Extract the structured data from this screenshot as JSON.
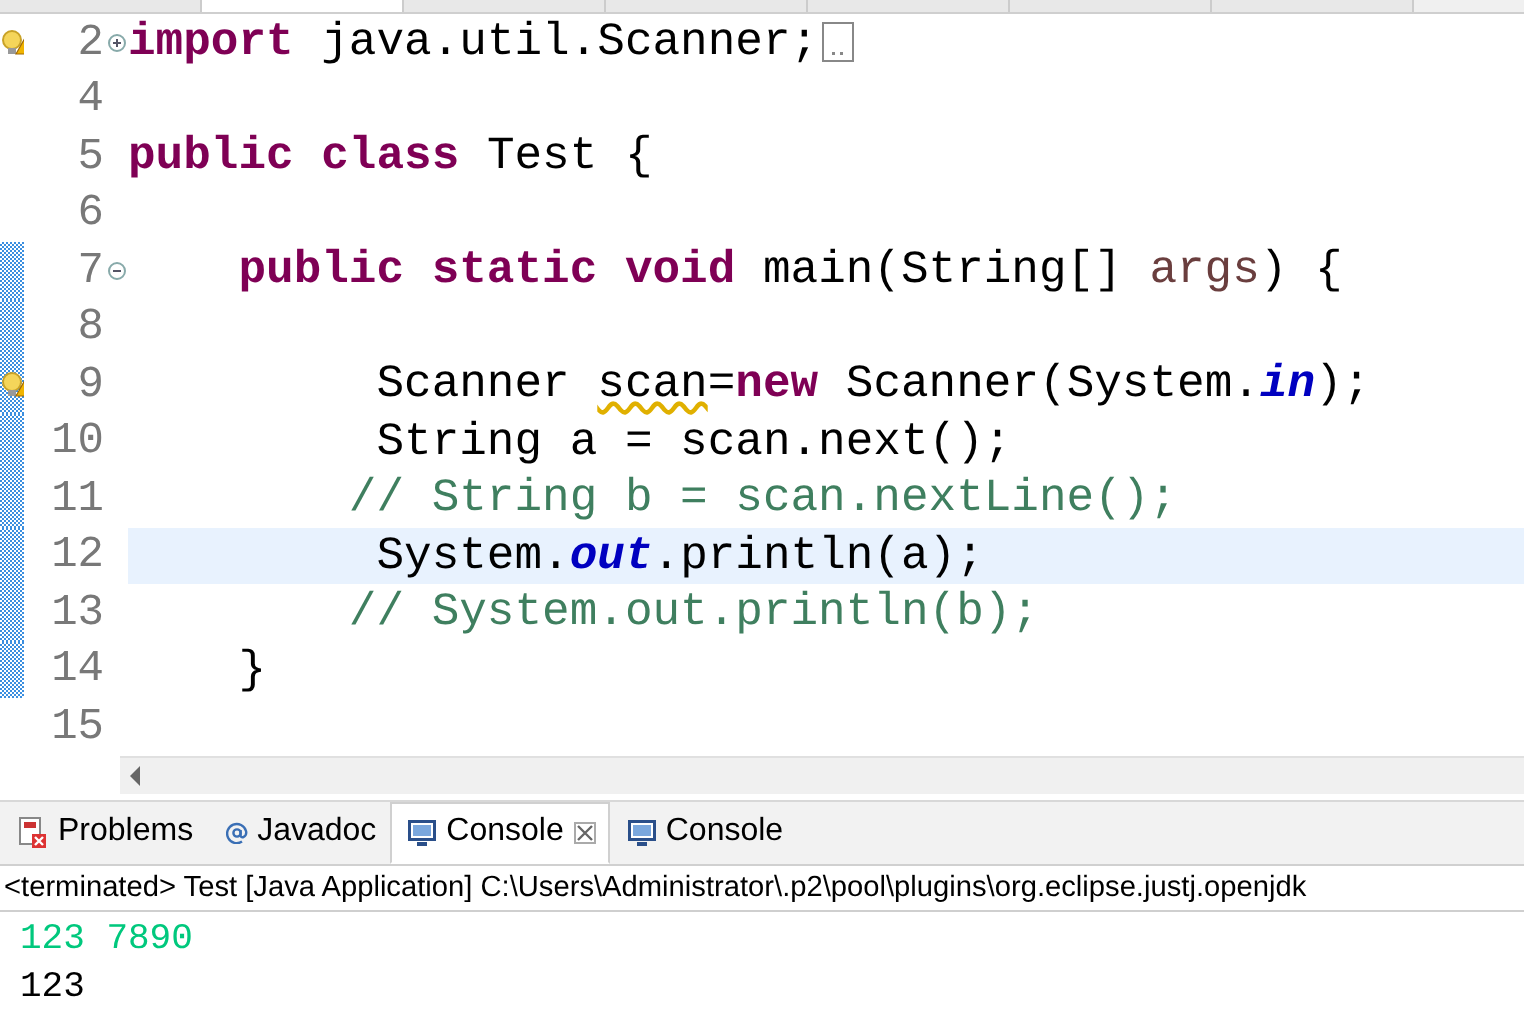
{
  "editor": {
    "lines": [
      {
        "number": "2",
        "current": false,
        "warning": true,
        "in_range": false,
        "fold": {
          "expanded": false
        },
        "segments": [
          {
            "kind": "keyword",
            "text": "import"
          },
          {
            "kind": "plain",
            "text": " java.util.Scanner;"
          }
        ]
      },
      {
        "number": "4",
        "current": false,
        "warning": false,
        "in_range": false
      },
      {
        "number": "5",
        "current": false,
        "warning": false,
        "in_range": false,
        "segments": [
          {
            "kind": "keyword",
            "text": "public class"
          },
          {
            "kind": "plain",
            "text": " Test {"
          }
        ]
      },
      {
        "number": "6",
        "current": false,
        "warning": false,
        "in_range": false
      },
      {
        "number": "7",
        "current": false,
        "warning": false,
        "in_range": true,
        "fold": {
          "expanded": true
        },
        "segments": [
          {
            "kind": "keyword",
            "text": "    public static void"
          },
          {
            "kind": "plain",
            "text": " main(String[] "
          },
          {
            "kind": "param",
            "text": "args"
          },
          {
            "kind": "plain",
            "text": ") {"
          }
        ]
      },
      {
        "number": "8",
        "current": false,
        "warning": false,
        "in_range": true
      },
      {
        "number": "9",
        "current": false,
        "warning": true,
        "in_range": true,
        "segments": [
          {
            "kind": "plain",
            "text": "         Scanner "
          },
          {
            "kind": "warned",
            "text": "scan"
          },
          {
            "kind": "plain",
            "text": "="
          },
          {
            "kind": "keyword",
            "text": "new"
          },
          {
            "kind": "plain",
            "text": " Scanner(System."
          },
          {
            "kind": "field",
            "text": "in"
          },
          {
            "kind": "plain",
            "text": ");"
          }
        ]
      },
      {
        "number": "10",
        "current": false,
        "warning": false,
        "in_range": true,
        "segments": [
          {
            "kind": "plain",
            "text": "         String a = scan.next();"
          }
        ]
      },
      {
        "number": "11",
        "current": false,
        "warning": false,
        "in_range": true,
        "segments": [
          {
            "kind": "comment",
            "text": "        // String b = scan.nextLine();"
          }
        ]
      },
      {
        "number": "12",
        "current": true,
        "warning": false,
        "in_range": true,
        "segments": [
          {
            "kind": "plain",
            "text": "         System."
          },
          {
            "kind": "field",
            "text": "out"
          },
          {
            "kind": "plain",
            "text": ".println(a);"
          }
        ]
      },
      {
        "number": "13",
        "current": false,
        "warning": false,
        "in_range": true,
        "segments": [
          {
            "kind": "comment",
            "text": "        // System.out.println(b);"
          }
        ]
      },
      {
        "number": "14",
        "current": false,
        "warning": false,
        "in_range": true,
        "segments": [
          {
            "kind": "plain",
            "text": "    }"
          }
        ]
      },
      {
        "number": "15",
        "current": false,
        "warning": false,
        "in_range": false
      }
    ]
  },
  "panel": {
    "tabs": [
      {
        "kind": "problems",
        "label": "Problems",
        "selected": false
      },
      {
        "kind": "javadoc",
        "label": "Javadoc",
        "selected": false
      },
      {
        "kind": "console",
        "label": "Console",
        "selected": true
      },
      {
        "kind": "console",
        "label": "Console",
        "selected": false
      }
    ],
    "console_header": "<terminated> Test [Java Application] C:\\Users\\Administrator\\.p2\\pool\\plugins\\org.eclipse.justj.openjdk",
    "output": [
      {
        "kind": "input",
        "text": "123 7890"
      },
      {
        "kind": "output",
        "text": "123"
      }
    ]
  }
}
